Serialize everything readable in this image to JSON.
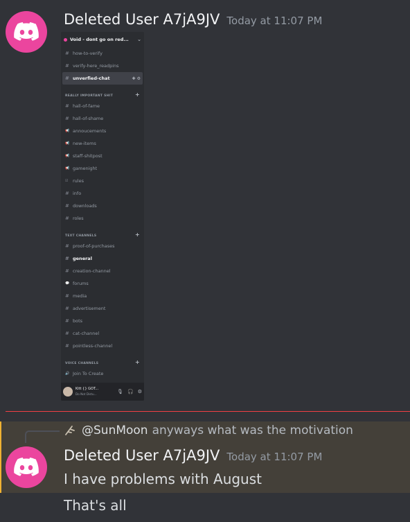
{
  "message1": {
    "author": "Deleted User A7jA9JV",
    "timestamp": "Today at 11:07 PM"
  },
  "embed": {
    "server_name": "Void - dont go on red...",
    "top_channels": [
      {
        "name": "how-to-verify",
        "icon": "#"
      },
      {
        "name": "verify-here_readpins",
        "icon": "#"
      }
    ],
    "selected_channel": {
      "name": "unverfied-chat",
      "icon": "#"
    },
    "categories": [
      {
        "name": "REALLY IMPORTANT SHIT",
        "channels": [
          {
            "name": "hall-of-fame",
            "icon": "#"
          },
          {
            "name": "hall-of-shame",
            "icon": "#"
          },
          {
            "name": "annoucements",
            "icon": "megaphone"
          },
          {
            "name": "new-items",
            "icon": "megaphone"
          },
          {
            "name": "staff-shitpost",
            "icon": "megaphone"
          },
          {
            "name": "gamenight",
            "icon": "megaphone"
          },
          {
            "name": "rules",
            "icon": "rules"
          },
          {
            "name": "info",
            "icon": "#"
          },
          {
            "name": "downloads",
            "icon": "#"
          },
          {
            "name": "roles",
            "icon": "#"
          }
        ]
      },
      {
        "name": "TEXT CHANNELS",
        "channels": [
          {
            "name": "proof-of-purchases",
            "icon": "#"
          },
          {
            "name": "general",
            "icon": "#",
            "bold": true
          },
          {
            "name": "creation-channel",
            "icon": "#"
          },
          {
            "name": "forums",
            "icon": "forum"
          },
          {
            "name": "media",
            "icon": "#"
          },
          {
            "name": "advertisement",
            "icon": "#"
          },
          {
            "name": "bots",
            "icon": "#"
          },
          {
            "name": "cat-channel",
            "icon": "#"
          },
          {
            "name": "pointless-channel",
            "icon": "#"
          }
        ]
      },
      {
        "name": "VOICE CHANNELS",
        "channels": [
          {
            "name": "Join To Create",
            "icon": "speaker"
          }
        ]
      }
    ],
    "user": {
      "name": "Kitt {} GOT...",
      "status": "Do Not Distu..."
    }
  },
  "reply": {
    "mention": "@SunMoon",
    "text": "anyways what was the motivation"
  },
  "message2": {
    "author": "Deleted User A7jA9JV",
    "timestamp": "Today at 11:07 PM",
    "lines": [
      "I have problems with August",
      "That's all"
    ]
  },
  "colors": {
    "background": "#313338",
    "avatar": "#eb459e",
    "highlight": "#444039",
    "new_divider": "#f23f43"
  }
}
